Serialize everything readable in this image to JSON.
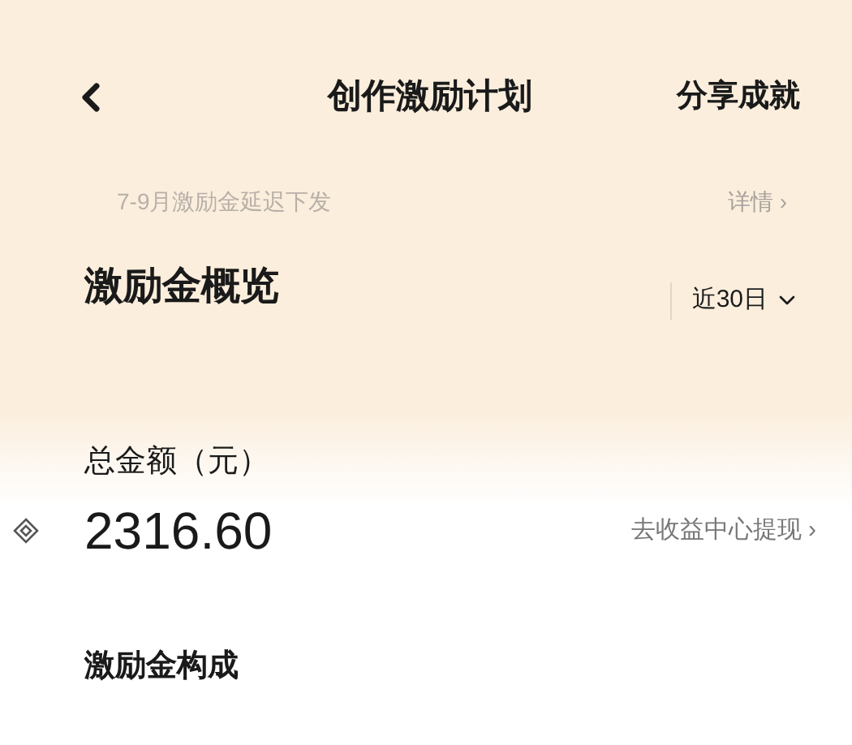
{
  "header": {
    "title": "创作激励计划",
    "action": "分享成就"
  },
  "notice": {
    "text": "7-9月激励金延迟下发",
    "link": "详情",
    "link_arrow": "›"
  },
  "overview": {
    "title": "激励金概览",
    "range": "近30日"
  },
  "total": {
    "label": "总金额（元）",
    "amount": "2316.60",
    "link": "去收益中心提现",
    "link_arrow": "›"
  },
  "composition": {
    "title": "激励金构成"
  }
}
